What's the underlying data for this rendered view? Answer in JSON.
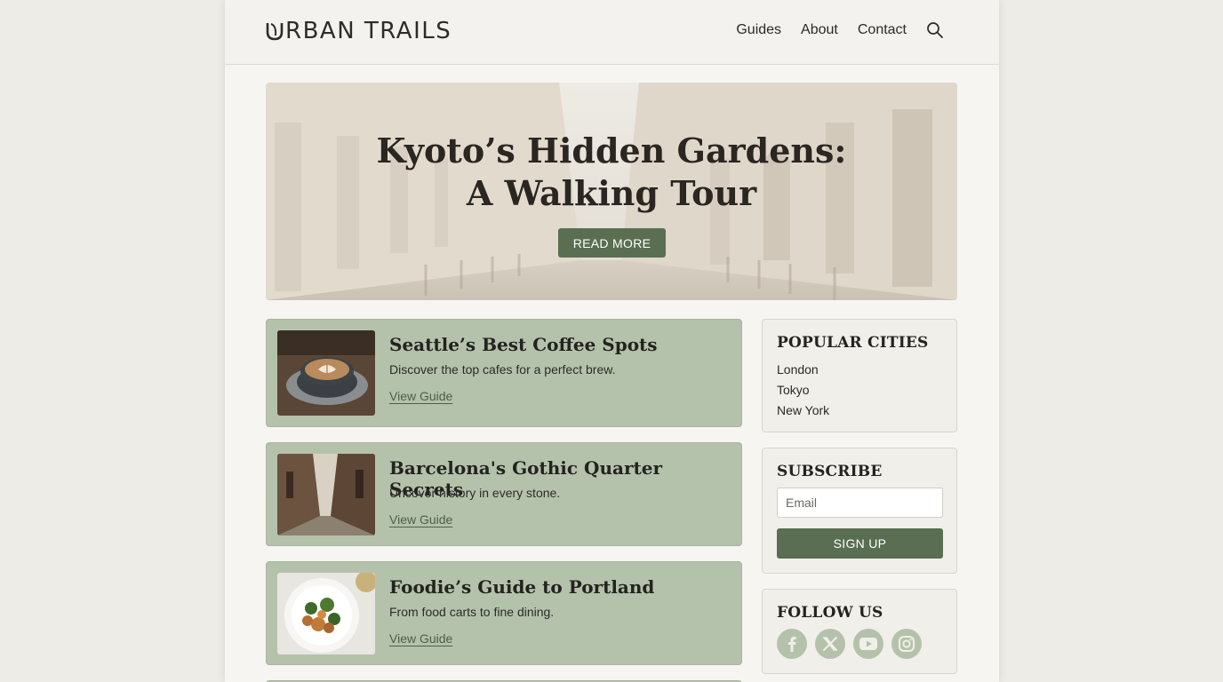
{
  "brand": {
    "logo_text": "RBAN TRAILS",
    "logo_icon": "leaf-u-icon"
  },
  "nav": {
    "items": [
      "Guides",
      "About",
      "Contact"
    ],
    "search_icon": "search-icon"
  },
  "hero": {
    "title_line1": "Kyoto’s Hidden Gardens:",
    "title_line2": "A Walking Tour",
    "button": "READ MORE"
  },
  "guides": [
    {
      "title": "Seattle’s Best Coffee Spots",
      "description": "Discover the top cafes for a perfect brew.",
      "link": "View Guide",
      "thumb": "coffee-cup-image"
    },
    {
      "title": "Barcelona's Gothic Quarter Secrets",
      "description": "Uncover history in every stone.",
      "link": "View Guide",
      "thumb": "gothic-alley-image"
    },
    {
      "title": "Foodie’s Guide to Portland",
      "description": "From food carts to fine dining.",
      "link": "View Guide",
      "thumb": "food-plate-image"
    }
  ],
  "sidebar": {
    "popular": {
      "title": "POPULAR CITIES",
      "cities": [
        "London",
        "Tokyo",
        "New York"
      ]
    },
    "subscribe": {
      "title": "SUBSCRIBE",
      "email_placeholder": "Email",
      "button": "SIGN UP"
    },
    "follow": {
      "title": "FOLLOW US",
      "icons": [
        "facebook-icon",
        "x-icon",
        "youtube-icon",
        "instagram-icon"
      ]
    }
  },
  "colors": {
    "accent": "#5a6e51",
    "card_bg": "#b5c2ab",
    "page_bg": "#eeece6"
  }
}
